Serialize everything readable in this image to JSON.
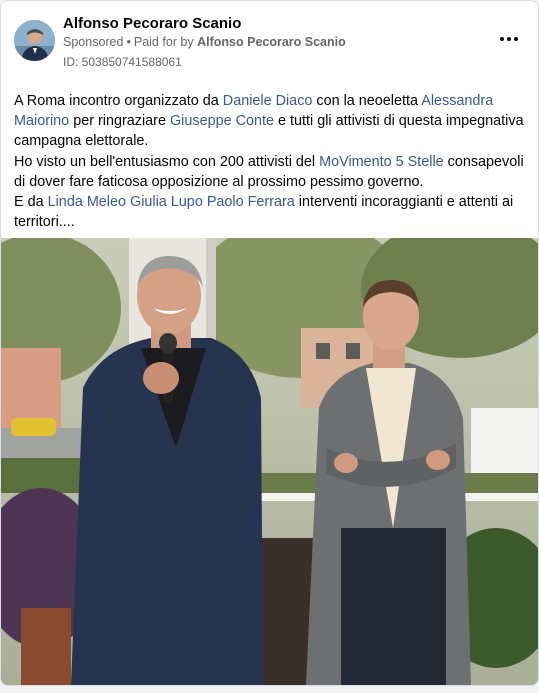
{
  "post": {
    "author": "Alfonso Pecoraro Scanio",
    "sponsored_label": "Sponsored",
    "separator": "•",
    "paid_for_prefix": "Paid for by",
    "paid_for_name": "Alfonso Pecoraro Scanio",
    "ad_id_label": "ID: 503850741588061",
    "more_icon": "more-horizontal-icon"
  },
  "text": {
    "p1": {
      "t1": "A Roma incontro organizzato da ",
      "l1": "Daniele Diaco",
      "t2": " con la neoeletta ",
      "l2": "Alessandra Maiorino",
      "t3": " per ringraziare ",
      "l3": "Giuseppe Conte",
      "t4": " e tutti gli attivisti di questa impegnativa campagna elettorale."
    },
    "p2": {
      "t1": "Ho visto un bell'entusiasmo con 200 attivisti del ",
      "l1": "MoVimento 5 Stelle",
      "t2": " consapevoli di dover fare faticosa opposizione al prossimo pessimo governo."
    },
    "p3": {
      "t1": "E da ",
      "l1": "Linda Meleo",
      "s1": " ",
      "l2": "Giulia Lupo",
      "s2": " ",
      "l3": "Paolo Ferrara",
      "t2": " interventi incoraggianti e attenti ai territori...."
    }
  },
  "colors": {
    "link": "#385898",
    "text": "#050505",
    "secondary": "#65676b"
  }
}
